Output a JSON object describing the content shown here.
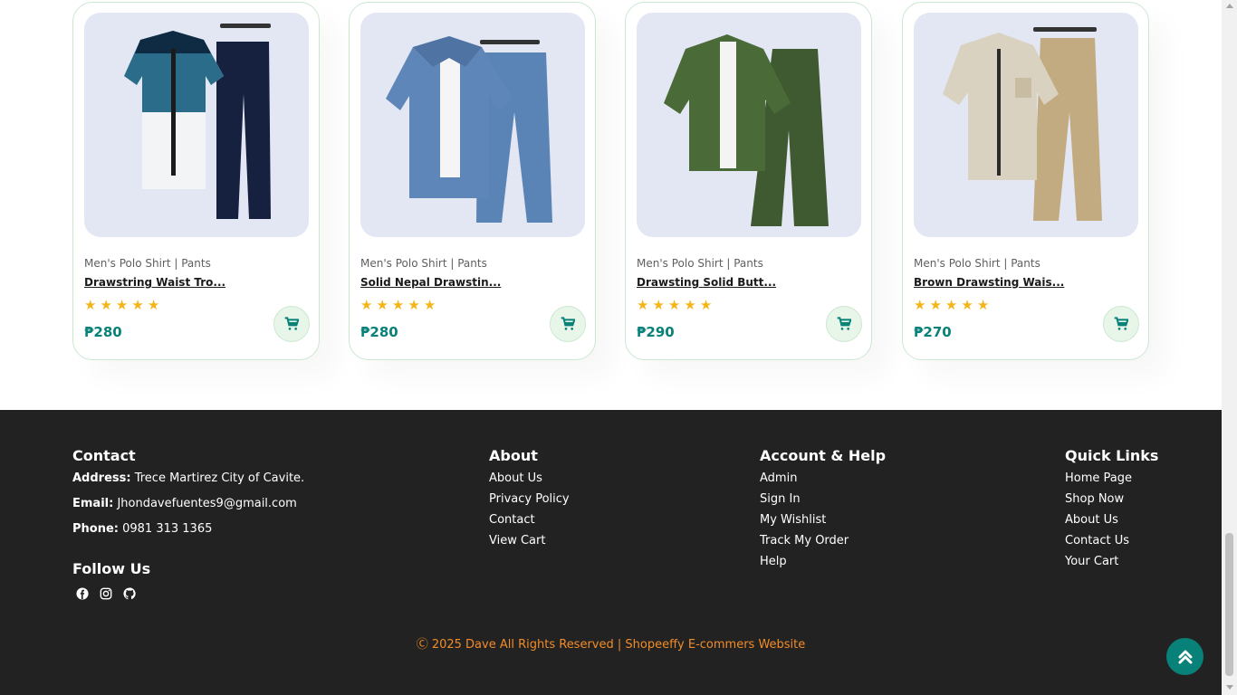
{
  "products": [
    {
      "brand": "Men's Polo Shirt | Pants",
      "title": "Drawstring Waist Tro...",
      "price": "₱280",
      "rating": 5,
      "image": "navy-gradient-shirt-and-navy-pants"
    },
    {
      "brand": "Men's Polo Shirt | Pants",
      "title": "Solid Nepal Drawstin...",
      "price": "₱280",
      "rating": 5,
      "image": "blue-shirt-and-blue-pants"
    },
    {
      "brand": "Men's Polo Shirt | Pants",
      "title": "Drawsting Solid Butt...",
      "price": "₱290",
      "rating": 5,
      "image": "green-shirt-and-green-pants"
    },
    {
      "brand": "Men's Polo Shirt | Pants",
      "title": "Brown Drawsting Wais...",
      "price": "₱270",
      "rating": 5,
      "image": "beige-shirt-and-khaki-pants"
    }
  ],
  "footer": {
    "contact": {
      "heading": "Contact",
      "address_label": "Address:",
      "address": " Trece Martirez City of Cavite.",
      "email_label": "Email:",
      "email": " Jhondavefuentes9@gmail.com",
      "phone_label": "Phone:",
      "phone": " 0981 313 1365"
    },
    "follow": {
      "heading": "Follow Us",
      "icons": [
        "facebook-icon",
        "instagram-icon",
        "github-icon"
      ]
    },
    "about": {
      "heading": "About",
      "links": [
        "About Us",
        "Privacy Policy",
        "Contact",
        "View Cart"
      ]
    },
    "account": {
      "heading": "Account & Help",
      "links": [
        "Admin",
        "Sign In",
        "My Wishlist",
        "Track My Order",
        "Help"
      ]
    },
    "quick": {
      "heading": "Quick Links",
      "links": [
        "Home Page",
        "Shop Now",
        "About Us",
        "Contact Us",
        "Your Cart"
      ]
    },
    "copyright": "Ⓒ 2025 Dave All Rights Reserved | Shopeeffy E-commers Website"
  },
  "colors": {
    "accent": "#088178",
    "star": "#f3b519",
    "footer_bg": "#222222",
    "copyright": "#f28c28",
    "image_bg": "#e3e6f3"
  }
}
